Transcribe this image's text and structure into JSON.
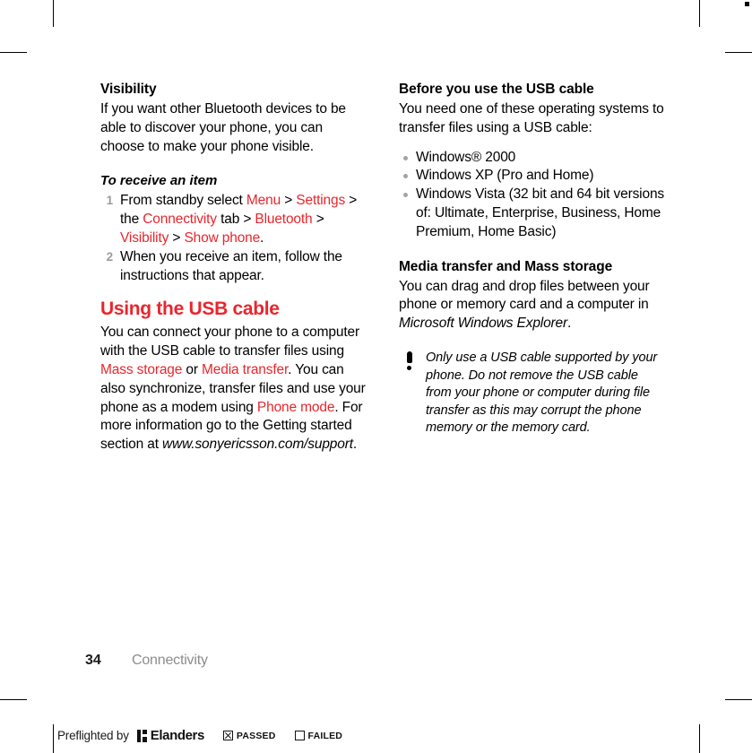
{
  "document": {
    "page_number": "34",
    "chapter": "Connectivity"
  },
  "left_column": {
    "visibility_heading": "Visibility",
    "visibility_body": "If you want other Bluetooth devices to be able to discover your phone, you can choose to make your phone visible.",
    "procedure_heading": "To receive an item",
    "steps": [
      {
        "number": "1",
        "parts": [
          {
            "text": "From standby select ",
            "style": "plain"
          },
          {
            "text": "Menu",
            "style": "red"
          },
          {
            "text": " > ",
            "style": "plain"
          },
          {
            "text": "Settings",
            "style": "red"
          },
          {
            "text": " > the ",
            "style": "plain"
          },
          {
            "text": "Connectivity",
            "style": "red"
          },
          {
            "text": " tab > ",
            "style": "plain"
          },
          {
            "text": "Bluetooth",
            "style": "red"
          },
          {
            "text": " > ",
            "style": "plain"
          },
          {
            "text": "Visibility",
            "style": "red"
          },
          {
            "text": " > ",
            "style": "plain"
          },
          {
            "text": "Show phone",
            "style": "red"
          },
          {
            "text": ".",
            "style": "plain"
          }
        ]
      },
      {
        "number": "2",
        "parts": [
          {
            "text": "When you receive an item, follow the instructions that appear.",
            "style": "plain"
          }
        ]
      }
    ],
    "usb_heading": "Using the USB cable",
    "usb_body_parts": [
      {
        "text": "You can connect your phone to a computer with the USB cable to transfer files using ",
        "style": "plain"
      },
      {
        "text": "Mass storage",
        "style": "red"
      },
      {
        "text": " or ",
        "style": "plain"
      },
      {
        "text": "Media transfer",
        "style": "red"
      },
      {
        "text": ". You can also synchronize, transfer files and use your phone as a modem using ",
        "style": "plain"
      },
      {
        "text": "Phone mode",
        "style": "red"
      },
      {
        "text": ". For more information go to the Getting started section at ",
        "style": "plain"
      },
      {
        "text": "www.sonyericsson.com/support",
        "style": "italic"
      },
      {
        "text": ".",
        "style": "plain"
      }
    ]
  },
  "right_column": {
    "before_heading": "Before you use the USB cable",
    "before_body": "You need one of these operating systems to transfer files using a USB cable:",
    "os_list": [
      "Windows® 2000",
      "Windows XP (Pro and Home)",
      "Windows Vista (32 bit and 64 bit versions of: Ultimate, Enterprise, Business, Home Premium, Home Basic)"
    ],
    "media_heading": "Media transfer and Mass storage",
    "media_body_parts": [
      {
        "text": "You can drag and drop files between your phone or memory card and a computer in ",
        "style": "plain"
      },
      {
        "text": "Microsoft Windows Explorer",
        "style": "italic"
      },
      {
        "text": ".",
        "style": "plain"
      }
    ],
    "note_text": "Only use a USB cable supported by your phone. Do not remove the USB cable from your phone or computer during file transfer as this may corrupt the phone memory or the memory card."
  },
  "preflight": {
    "label": "Preflighted by",
    "brand": "Elanders",
    "passed_label": "PASSED",
    "failed_label": "FAILED",
    "passed_checked": true,
    "failed_checked": false
  },
  "colors": {
    "accent_red": "#e8262d",
    "muted_gray": "#8c8c8c",
    "bullet_gray": "#a3a3a3"
  }
}
